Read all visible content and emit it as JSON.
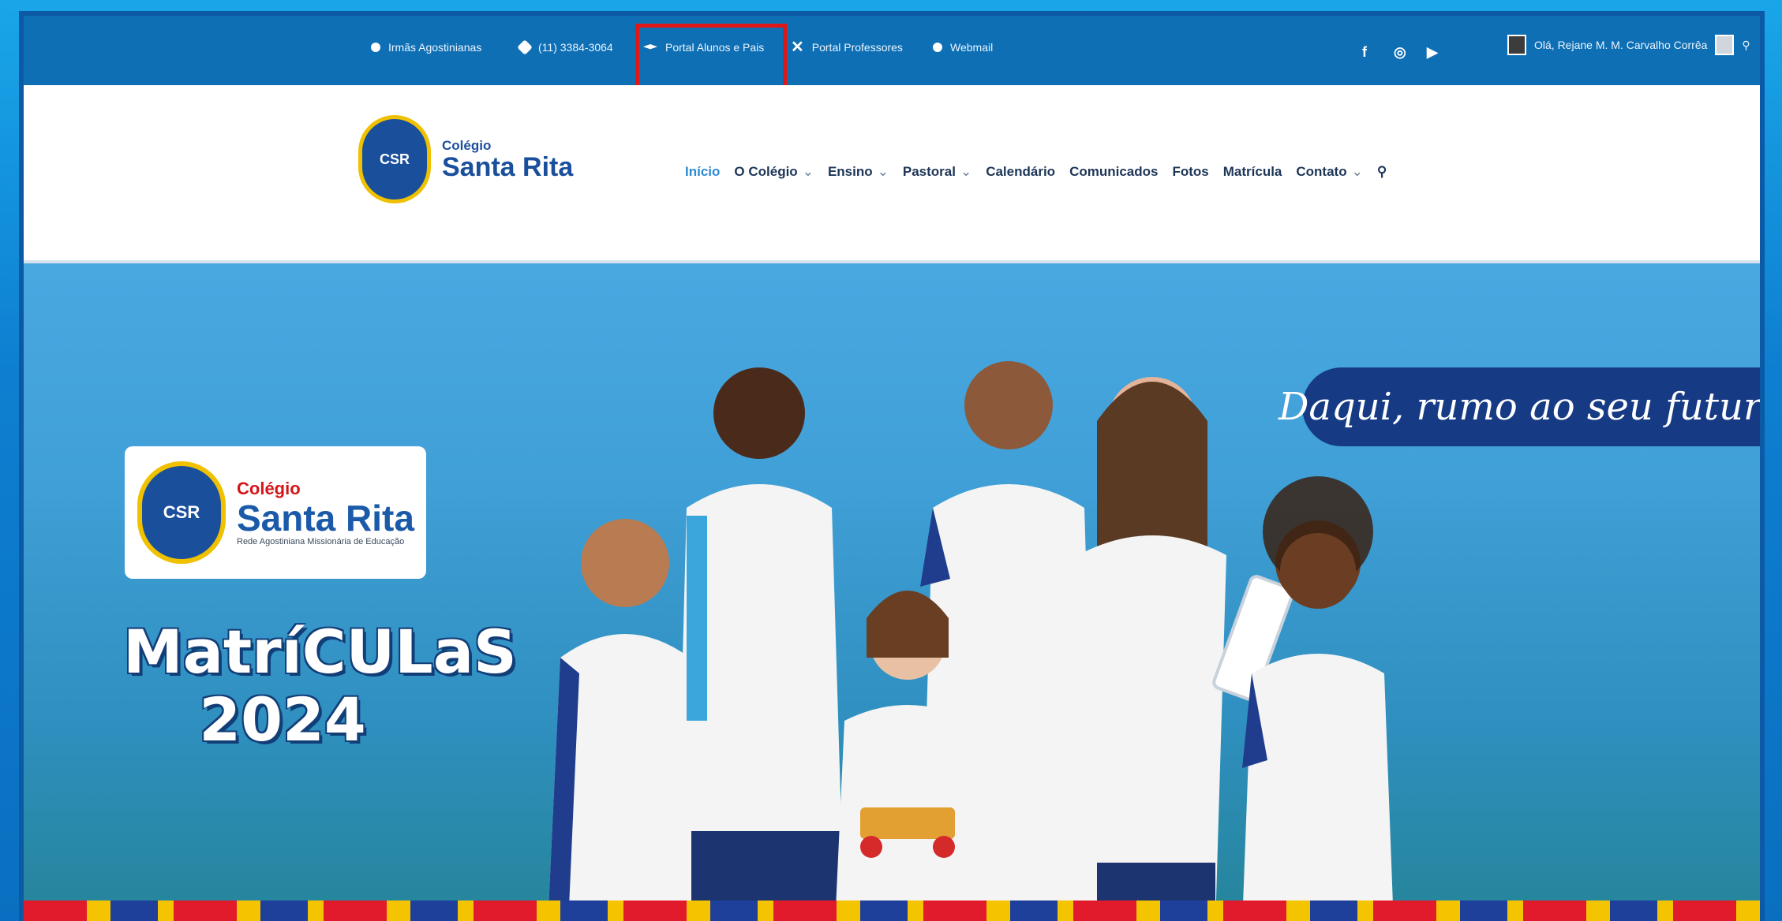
{
  "topbar": {
    "links": [
      {
        "label": "Irmãs Agostinianas",
        "icon": "info-circle-icon"
      },
      {
        "label": "(11) 3384-3064",
        "icon": "phone-icon"
      },
      {
        "label": "Portal Alunos e Pais",
        "icon": "graduation-cap-icon"
      },
      {
        "label": "Portal Professores",
        "icon": "x-icon"
      },
      {
        "label": "Webmail",
        "icon": "info-circle-icon"
      }
    ],
    "social": [
      "f",
      "◎",
      "▶"
    ],
    "user_greeting": "Olá, Rejane M. M. Carvalho Corrêa"
  },
  "header": {
    "brand_small": "Colégio",
    "brand_big": "Santa Rita",
    "seal_text": "CSR",
    "nav": [
      {
        "label": "Início",
        "active": true
      },
      {
        "label": "O Colégio",
        "dropdown": true
      },
      {
        "label": "Ensino",
        "dropdown": true
      },
      {
        "label": "Pastoral",
        "dropdown": true
      },
      {
        "label": "Calendário"
      },
      {
        "label": "Comunicados"
      },
      {
        "label": "Fotos"
      },
      {
        "label": "Matrícula"
      },
      {
        "label": "Contato",
        "dropdown": true
      }
    ]
  },
  "hero": {
    "logo_small": "Colégio",
    "logo_big": "Santa Rita",
    "logo_sub": "Rede Agostiniana Missionária de Educação",
    "title_line1": "MatríCULaS",
    "title_line2": "2024",
    "tagline": "Daqui, rumo ao seu futuro!"
  },
  "colors": {
    "topbar": "#0f6fb4",
    "highlight": "#e11717",
    "brand_blue": "#1a4f9c",
    "tagline_bg": "#163a84"
  }
}
